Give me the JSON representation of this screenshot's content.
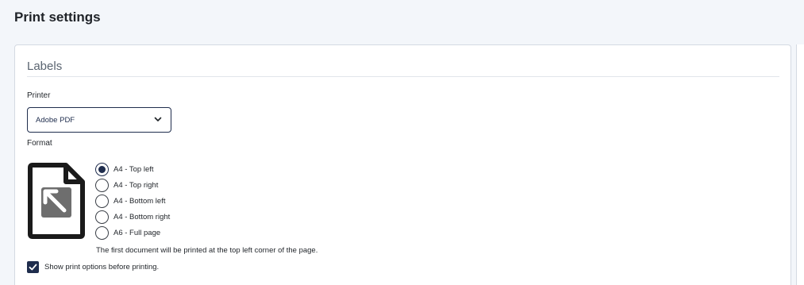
{
  "page": {
    "title": "Print settings"
  },
  "labels_section": {
    "title": "Labels",
    "printer": {
      "label": "Printer",
      "selected": "Adobe PDF"
    },
    "format": {
      "label": "Format",
      "icon": "document-arrow-top-left-icon",
      "options": [
        {
          "label": "A4 - Top left",
          "checked": true
        },
        {
          "label": "A4 - Top right",
          "checked": false
        },
        {
          "label": "A4 - Bottom left",
          "checked": false
        },
        {
          "label": "A4 - Bottom right",
          "checked": false
        },
        {
          "label": "A6 - Full page",
          "checked": false
        }
      ],
      "hint": "The first document will be printed at the top left corner of the page."
    },
    "show_options": {
      "label": "Show print options before printing.",
      "checked": true
    }
  },
  "colors": {
    "accent": "#1f2d4d",
    "background": "#f3f6fa",
    "card": "#ffffff"
  }
}
